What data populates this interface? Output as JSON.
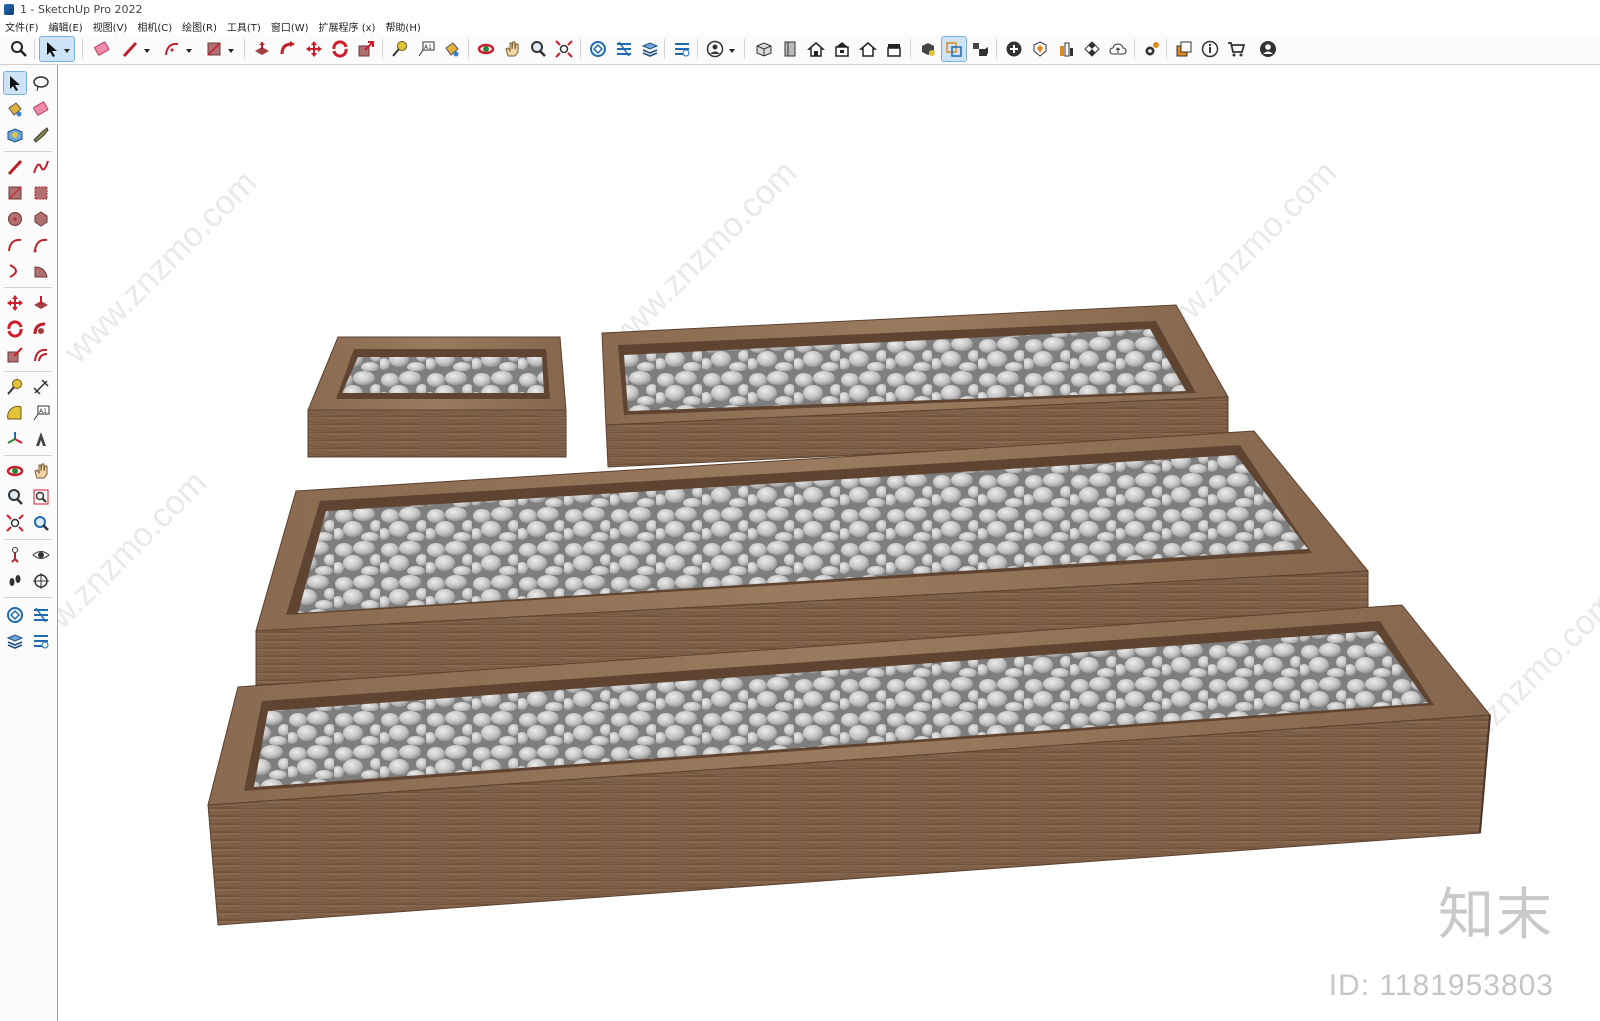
{
  "window": {
    "title": "1 - SketchUp Pro 2022"
  },
  "menu": [
    "文件(F)",
    "编辑(E)",
    "视图(V)",
    "相机(C)",
    "绘图(R)",
    "工具(T)",
    "窗口(W)",
    "扩展程序 (x)",
    "帮助(H)"
  ],
  "toolbar": {
    "tools": [
      "search",
      "select",
      "eraser",
      "line",
      "arc",
      "rectangle",
      "push-pull",
      "follow-me",
      "move",
      "rotate",
      "scale",
      "tape-measure",
      "text",
      "paint-bucket",
      "orbit",
      "pan",
      "zoom",
      "zoom-extents",
      "warehouse",
      "extension-warehouse",
      "layers",
      "extension-manager",
      "user",
      "iso-view",
      "top-view",
      "front-view",
      "right-view",
      "back-view",
      "left-view",
      "materials",
      "components",
      "scenes",
      "add-location",
      "solar",
      "styles",
      "texture",
      "upload",
      "settings",
      "outliner",
      "info",
      "cart",
      "account"
    ]
  },
  "palette": {
    "tools": [
      "select",
      "orbit",
      "paint",
      "eraser",
      "component",
      "tag",
      "line",
      "freehand",
      "rectangle",
      "rotated-rectangle",
      "circle",
      "polygon",
      "arc",
      "pie",
      "arc-3pt",
      "arc-2pt",
      "move",
      "push-pull",
      "rotate",
      "follow-me",
      "scale",
      "offset",
      "tape-measure",
      "dimension",
      "protractor",
      "text",
      "axes",
      "section",
      "orbit2",
      "pan",
      "zoom",
      "zoom-window",
      "zoom-extents",
      "previous",
      "position-camera",
      "look-around",
      "walk",
      "section-plane",
      "warehouse",
      "share-model",
      "layers",
      "extension"
    ]
  },
  "viewport": {
    "watermark_text": "www.znzmo.com",
    "brand_mark": "知末",
    "asset_id": "ID: 1181953803"
  },
  "colors": {
    "wood_top": "#8a6a50",
    "wood_front": "#7a5c42",
    "wood_inner": "#5e4431",
    "stone": "#cfcfcf",
    "stone_shadow": "#8e8e8e",
    "active_tool": "#cde3f7"
  }
}
